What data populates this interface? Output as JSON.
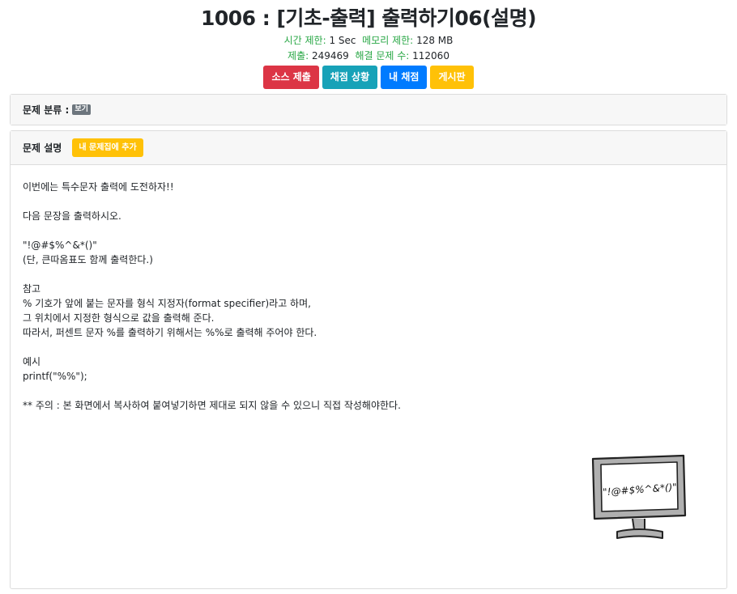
{
  "header": {
    "title": "1006 : [기초-출력] 출력하기06(설명)",
    "time_limit_label": "시간 제한:",
    "time_limit_value": "1 Sec",
    "memory_limit_label": "메모리 제한:",
    "memory_limit_value": "128 MB",
    "submissions_label": "제출:",
    "submissions_value": "249469",
    "solved_label": "해결 문제 수:",
    "solved_value": "112060"
  },
  "buttons": {
    "submit": "소스 제출",
    "status": "채점 상황",
    "my_status": "내 채점",
    "board": "게시판"
  },
  "category": {
    "label": "문제 분류 :",
    "show_badge": "보기"
  },
  "description": {
    "label": "문제 설명",
    "add_button": "내 문제집에 추가",
    "lines": [
      "이번에는 특수문자 출력에 도전하자!!",
      "",
      "다음 문장을 출력하시오.",
      "",
      "\"!@#$%^&*()\"",
      "(단, 큰따옴표도 함께 출력한다.)",
      "",
      "참고",
      "% 기호가 앞에 붙는 문자를 형식 지정자(format specifier)라고 하며,",
      "그 위치에서 지정한 형식으로 값을 출력해 준다.",
      "따라서, 퍼센트 문자 %를 출력하기 위해서는 %%로 출력해 주어야 한다.",
      "",
      "예시",
      "printf(\"%%\");",
      "",
      "** 주의 : 본 화면에서 복사하여 붙여넣기하면 제대로 되지 않을 수 있으니 직접 작성해야한다."
    ],
    "illustration_text": "\"!@#$%^&*()\""
  }
}
